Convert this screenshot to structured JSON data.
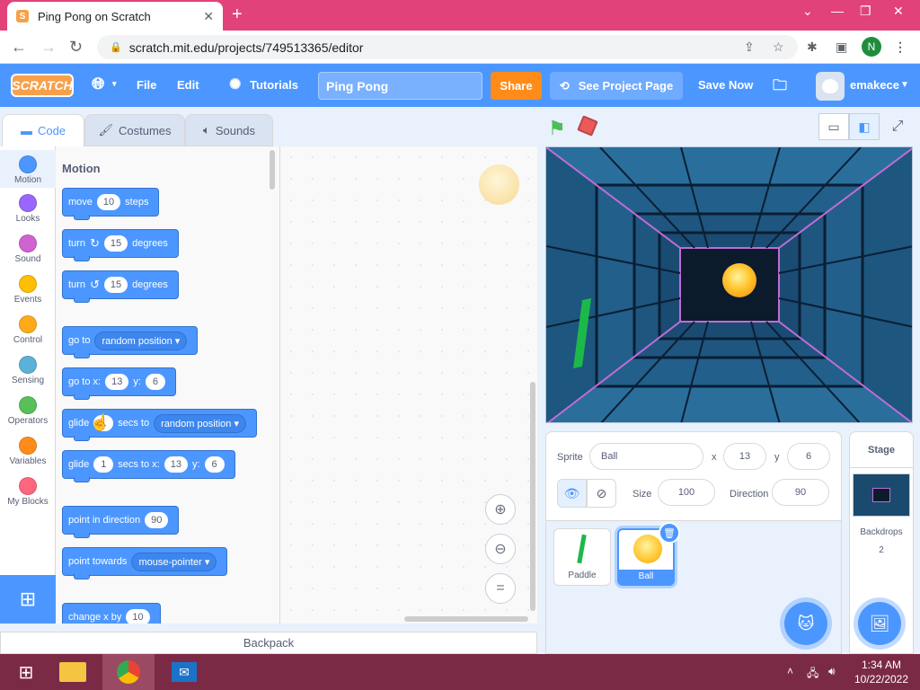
{
  "browser": {
    "tab_title": "Ping Pong on Scratch",
    "url": "scratch.mit.edu/projects/749513365/editor",
    "profile_initial": "N",
    "accent": "#e2427a"
  },
  "menubar": {
    "logo": "SCRATCH",
    "file": "File",
    "edit": "Edit",
    "tutorials": "Tutorials",
    "project_title": "Ping Pong",
    "share": "Share",
    "see_project_page": "See Project Page",
    "save_now": "Save Now",
    "username": "emakece",
    "color": "#4c97ff"
  },
  "editor_tabs": {
    "code": "Code",
    "costumes": "Costumes",
    "sounds": "Sounds"
  },
  "categories": [
    {
      "label": "Motion",
      "color": "#4c97ff"
    },
    {
      "label": "Looks",
      "color": "#9966ff"
    },
    {
      "label": "Sound",
      "color": "#cf63cf"
    },
    {
      "label": "Events",
      "color": "#ffbf00"
    },
    {
      "label": "Control",
      "color": "#ffab19"
    },
    {
      "label": "Sensing",
      "color": "#5cb1d6"
    },
    {
      "label": "Operators",
      "color": "#59c059"
    },
    {
      "label": "Variables",
      "color": "#ff8c1a"
    },
    {
      "label": "My Blocks",
      "color": "#ff6680"
    }
  ],
  "palette": {
    "heading": "Motion",
    "move": {
      "w1": "move",
      "steps": "10",
      "w2": "steps"
    },
    "turn_right": {
      "w1": "turn",
      "deg": "15",
      "w2": "degrees"
    },
    "turn_left": {
      "w1": "turn",
      "deg": "15",
      "w2": "degrees"
    },
    "goto": {
      "w1": "go to",
      "target": "random position"
    },
    "goto_xy": {
      "w1": "go to x:",
      "x": "13",
      "w2": "y:",
      "y": "6"
    },
    "glide_to": {
      "w1": "glide",
      "secs": "1",
      "w2": "secs to",
      "target": "random position"
    },
    "glide_xy": {
      "w1": "glide",
      "secs": "1",
      "w2": "secs to x:",
      "x": "13",
      "w3": "y:",
      "y": "6"
    },
    "point_dir": {
      "w1": "point in direction",
      "dir": "90"
    },
    "point_towards": {
      "w1": "point towards",
      "target": "mouse-pointer"
    },
    "change_x": {
      "w1": "change x by",
      "val": "10"
    }
  },
  "backpack": "Backpack",
  "sprite_info": {
    "sprite_label": "Sprite",
    "sprite_name": "Ball",
    "x_label": "x",
    "x": "13",
    "y_label": "y",
    "y": "6",
    "size_label": "Size",
    "size": "100",
    "direction_label": "Direction",
    "direction": "90"
  },
  "sprites": [
    {
      "name": "Paddle"
    },
    {
      "name": "Ball"
    }
  ],
  "stage_panel": {
    "title": "Stage",
    "backdrops_label": "Backdrops",
    "backdrops_count": "2"
  },
  "taskbar": {
    "time": "1:34 AM",
    "date": "10/22/2022"
  }
}
